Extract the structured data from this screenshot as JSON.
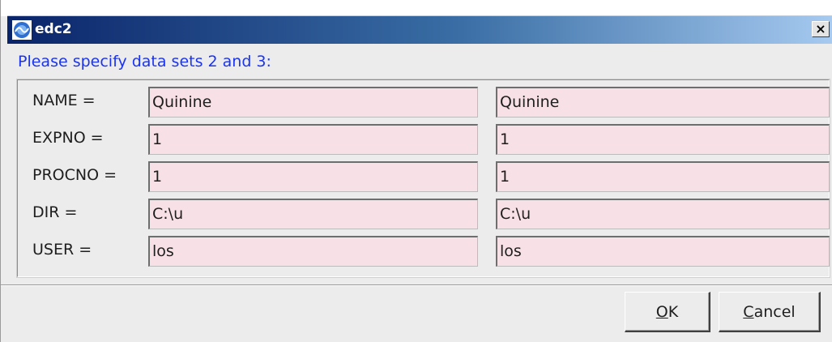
{
  "window": {
    "title": "edc2",
    "close_glyph": "×"
  },
  "prompt": "Please specify data sets 2 and 3:",
  "rows": [
    {
      "label": "NAME =",
      "value_set2": "Quinine",
      "value_set3": "Quinine"
    },
    {
      "label": "EXPNO =",
      "value_set2": "1",
      "value_set3": "1"
    },
    {
      "label": "PROCNO =",
      "value_set2": "1",
      "value_set3": "1"
    },
    {
      "label": "DIR =",
      "value_set2": "C:\\u",
      "value_set3": "C:\\u"
    },
    {
      "label": "USER =",
      "value_set2": "los",
      "value_set3": "los"
    }
  ],
  "buttons": {
    "ok": {
      "mnemonic": "O",
      "rest": "K"
    },
    "cancel": {
      "mnemonic": "C",
      "rest": "ancel"
    }
  },
  "colors": {
    "prompt_text": "#1b34f0",
    "field_background": "#f8e1e6",
    "titlebar_start": "#0a246a",
    "titlebar_end": "#a6caf0"
  },
  "icons": {
    "app": "topspin-app-icon",
    "close": "close-icon"
  }
}
